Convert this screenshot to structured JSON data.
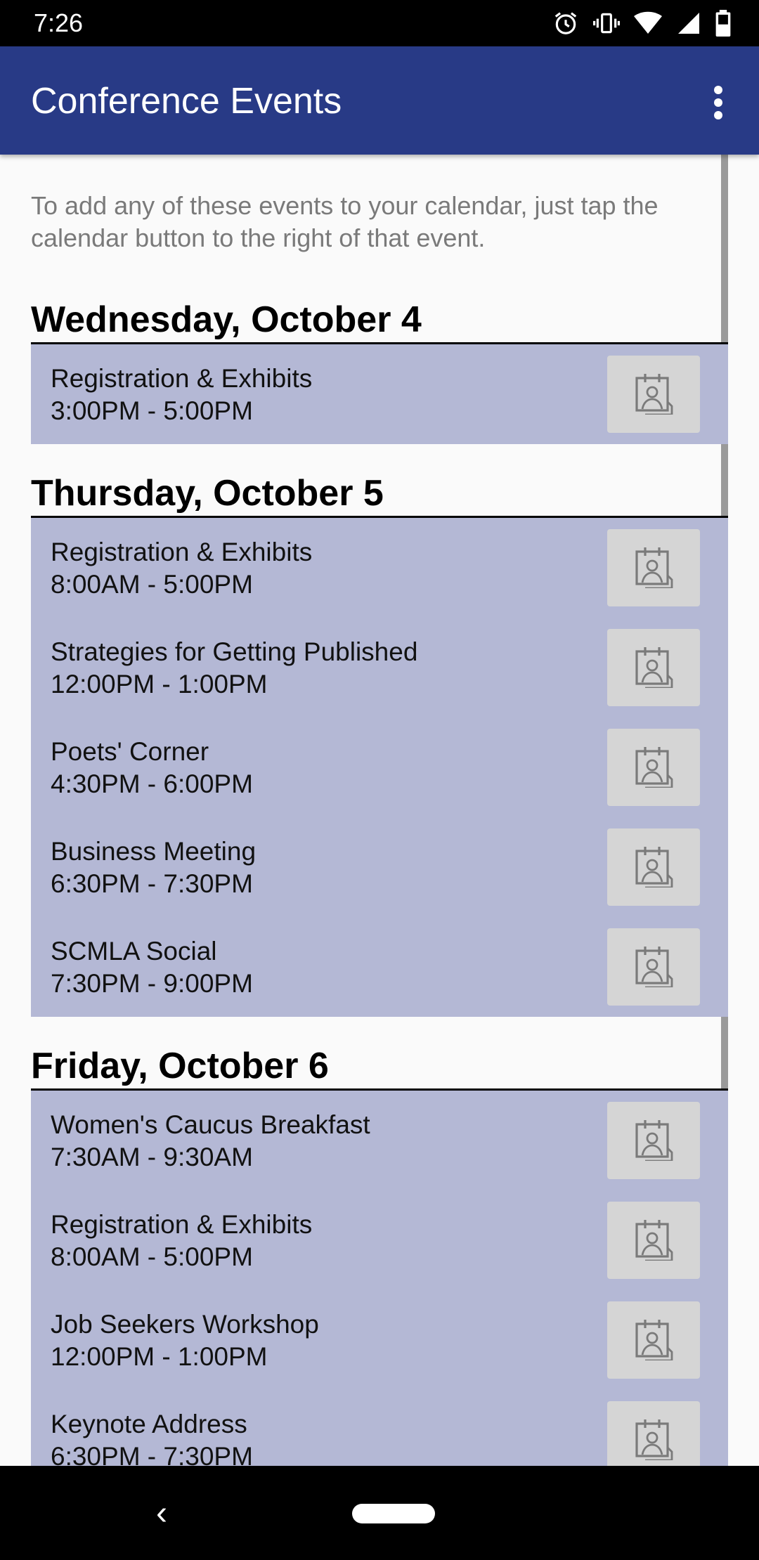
{
  "status_bar": {
    "time": "7:26"
  },
  "app_bar": {
    "title": "Conference Events"
  },
  "intro_text": "To add any of these events to your calendar, just tap the calendar button to the right of that event.",
  "days": [
    {
      "title": "Wednesday, October 4",
      "events": [
        {
          "name": "Registration & Exhibits",
          "time": "3:00PM - 5:00PM"
        }
      ]
    },
    {
      "title": "Thursday, October 5",
      "events": [
        {
          "name": "Registration & Exhibits",
          "time": "8:00AM - 5:00PM"
        },
        {
          "name": "Strategies for Getting Published",
          "time": "12:00PM - 1:00PM"
        },
        {
          "name": "Poets' Corner",
          "time": "4:30PM - 6:00PM"
        },
        {
          "name": "Business Meeting",
          "time": "6:30PM - 7:30PM"
        },
        {
          "name": "SCMLA Social",
          "time": "7:30PM - 9:00PM"
        }
      ]
    },
    {
      "title": "Friday, October 6",
      "events": [
        {
          "name": "Women's Caucus Breakfast",
          "time": "7:30AM - 9:30AM"
        },
        {
          "name": "Registration & Exhibits",
          "time": "8:00AM - 5:00PM"
        },
        {
          "name": "Job Seekers Workshop",
          "time": "12:00PM - 1:00PM"
        },
        {
          "name": "Keynote Address",
          "time": "6:30PM - 7:30PM"
        }
      ]
    }
  ],
  "nav_bar": {
    "back": "‹"
  },
  "colors": {
    "app_bar": "#283a86",
    "event_bg": "#b4b8d5",
    "button_bg": "#d5d5d5"
  }
}
